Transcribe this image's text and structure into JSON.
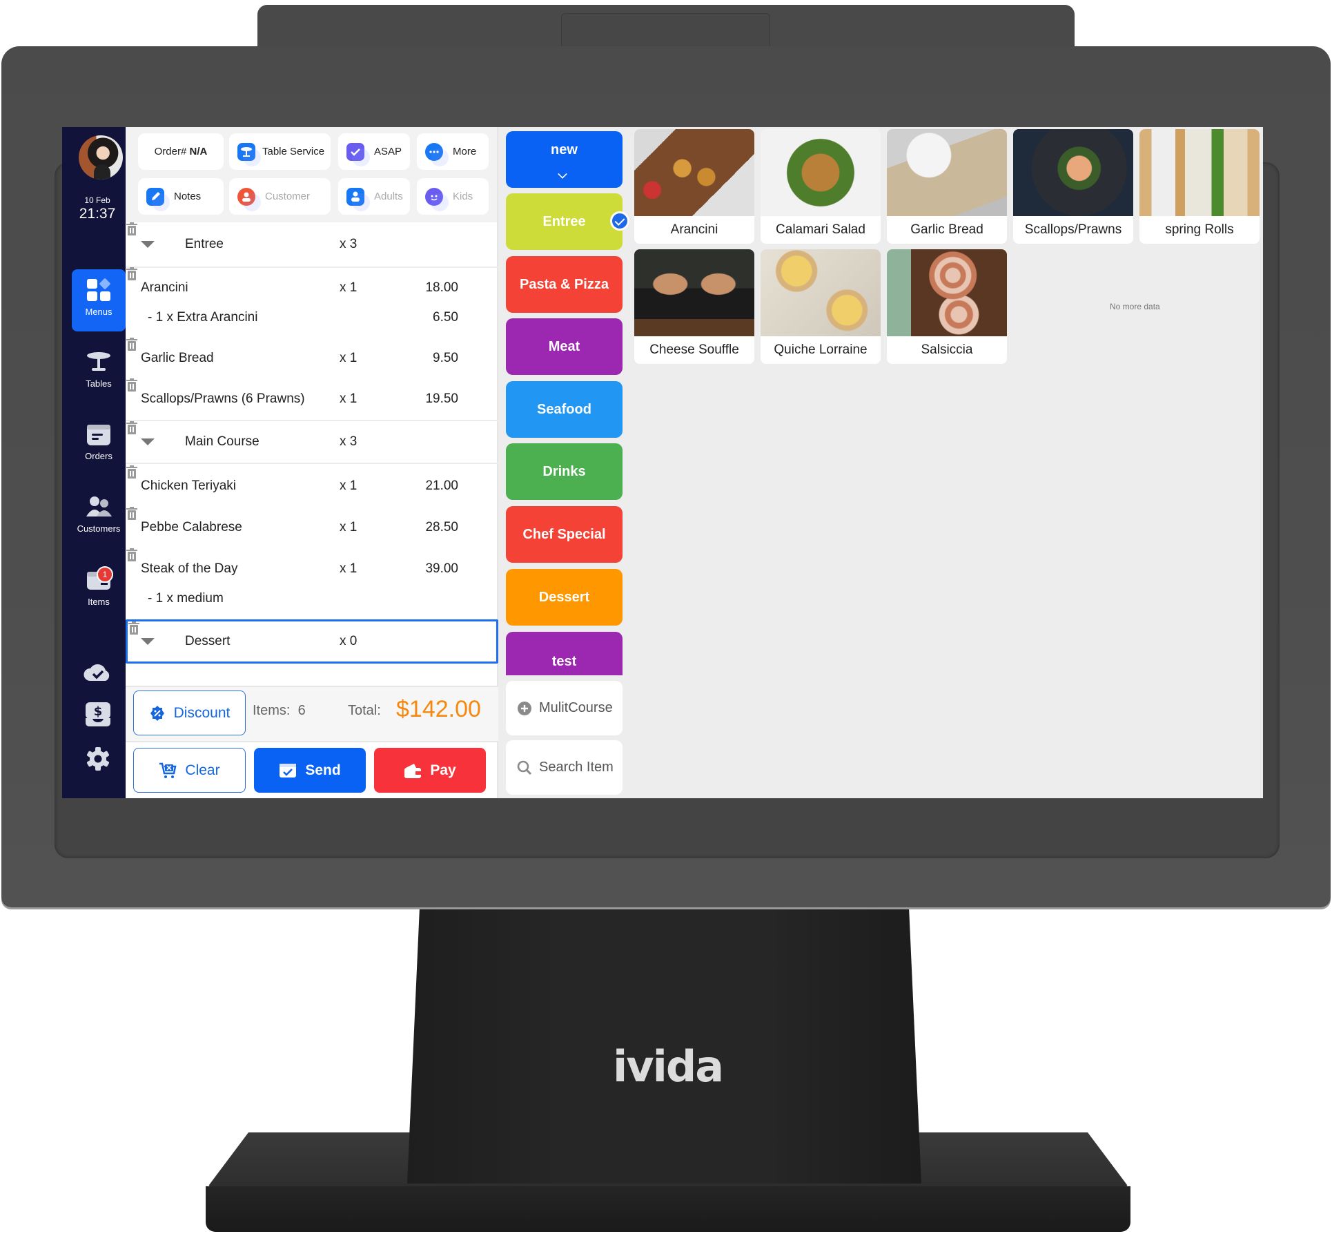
{
  "device": {
    "brand": "ivida"
  },
  "sidebar": {
    "date": "10 Feb",
    "time": "21:37",
    "nav": [
      {
        "label": "Menus",
        "icon": "menus-icon",
        "active": true
      },
      {
        "label": "Tables",
        "icon": "table-icon"
      },
      {
        "label": "Orders",
        "icon": "orders-icon"
      },
      {
        "label": "Customers",
        "icon": "customers-icon"
      },
      {
        "label": "Items",
        "icon": "items-icon",
        "badge": "1"
      }
    ],
    "utility_icons": [
      "cloud-sync-icon",
      "cash-drawer-icon",
      "settings-gear-icon"
    ]
  },
  "order_header": {
    "order_label": "Order#",
    "order_value": "N/A",
    "table_service": "Table Service",
    "asap": "ASAP",
    "more": "More",
    "notes": "Notes",
    "customer": "Customer",
    "adults": "Adults",
    "kids": "Kids"
  },
  "order": {
    "groups": [
      {
        "name": "Entree",
        "qty": "x 3",
        "items": [
          {
            "name": "Arancini",
            "qty": "x 1",
            "price": "18.00",
            "mods": [
              {
                "name": "- 1 x Extra Arancini",
                "price": "6.50"
              }
            ]
          },
          {
            "name": "Garlic Bread",
            "qty": "x 1",
            "price": "9.50"
          },
          {
            "name": "Scallops/Prawns (6 Prawns)",
            "qty": "x 1",
            "price": "19.50"
          }
        ]
      },
      {
        "name": "Main Course",
        "qty": "x 3",
        "items": [
          {
            "name": "Chicken Teriyaki",
            "qty": "x 1",
            "price": "21.00"
          },
          {
            "name": "Pebbe Calabrese",
            "qty": "x 1",
            "price": "28.50"
          },
          {
            "name": "Steak of the Day",
            "qty": "x 1",
            "price": "39.00",
            "mods": [
              {
                "name": "- 1 x medium"
              }
            ]
          }
        ]
      },
      {
        "name": "Dessert",
        "qty": "x 0",
        "selected": true,
        "items": []
      }
    ]
  },
  "summary": {
    "discount_label": "Discount",
    "items_label": "Items:",
    "items_count": "6",
    "total_label": "Total:",
    "total_value": "$142.00",
    "total_color": "#f5890f"
  },
  "actions": {
    "clear": "Clear",
    "send": "Send",
    "pay": "Pay"
  },
  "categories": [
    {
      "label": "new",
      "color": "#0a62f5",
      "dropdown": true
    },
    {
      "label": "Entree",
      "color": "#cddc39",
      "selected": true
    },
    {
      "label": "Pasta & Pizza",
      "color": "#f44336"
    },
    {
      "label": "Meat",
      "color": "#9c27b0"
    },
    {
      "label": "Seafood",
      "color": "#2196f3"
    },
    {
      "label": "Drinks",
      "color": "#4caf50"
    },
    {
      "label": "Chef Special",
      "color": "#f44336"
    },
    {
      "label": "Dessert",
      "color": "#ff9800"
    },
    {
      "label": "test",
      "color": "#9c27b0"
    }
  ],
  "tools": {
    "multicourse": "MulitCourse",
    "search": "Search Item"
  },
  "menu_items": [
    {
      "name": "Arancini"
    },
    {
      "name": "Calamari Salad"
    },
    {
      "name": "Garlic Bread"
    },
    {
      "name": "Scallops/Prawns"
    },
    {
      "name": "spring Rolls"
    },
    {
      "name": "Cheese Souffle"
    },
    {
      "name": "Quiche Lorraine"
    },
    {
      "name": "Salsiccia"
    }
  ],
  "no_more_data": "No more data"
}
